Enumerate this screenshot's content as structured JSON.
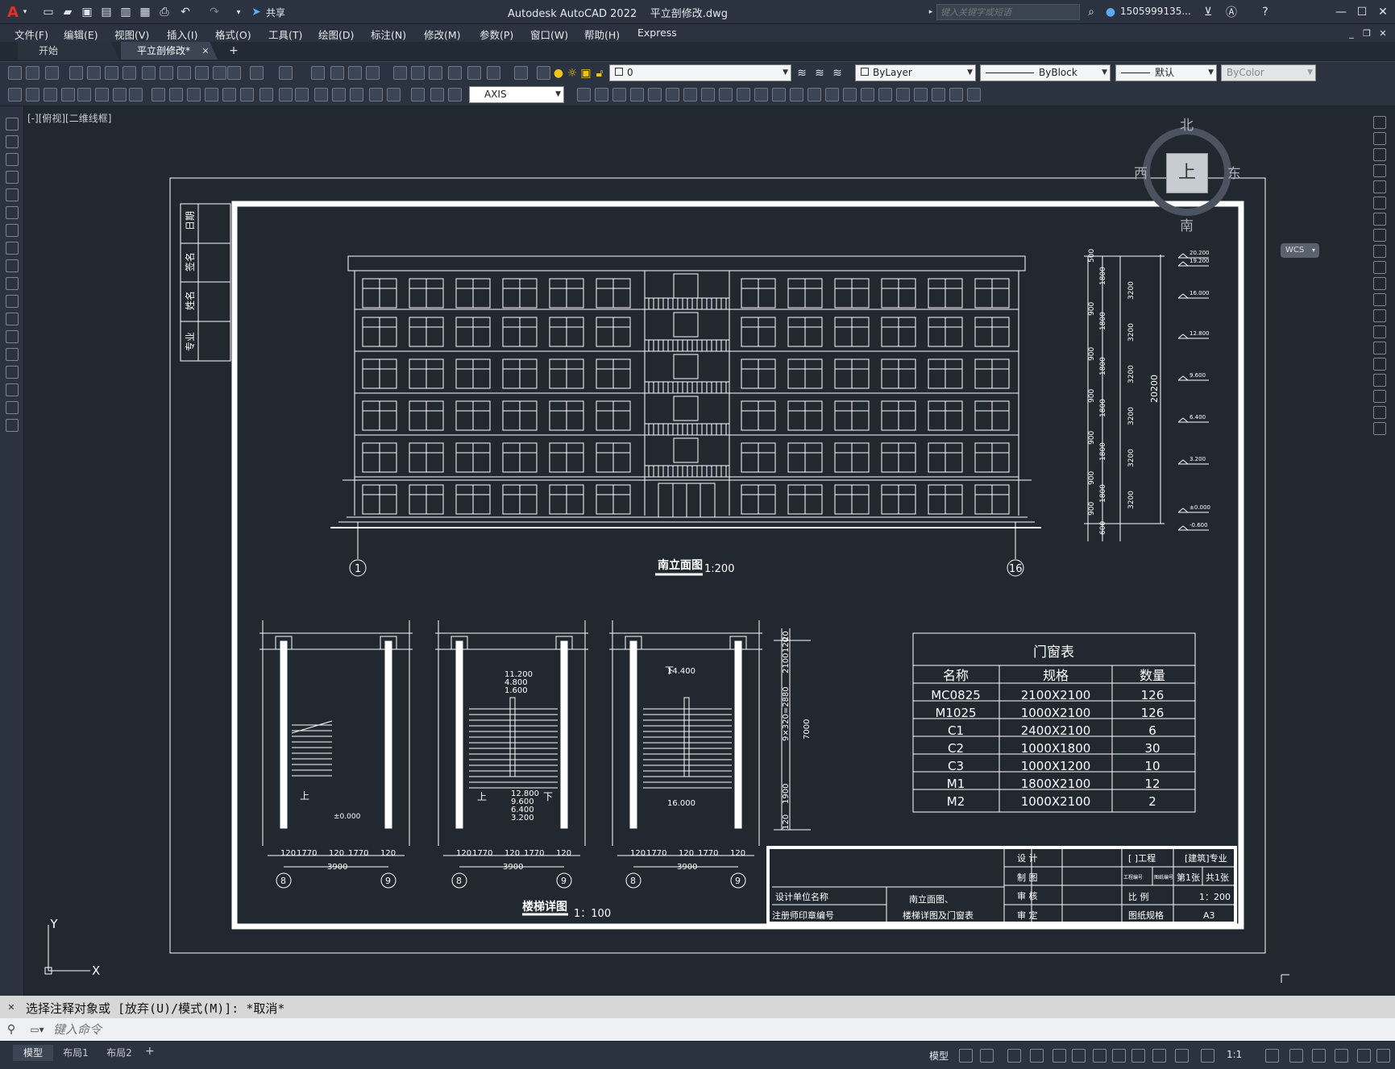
{
  "window": {
    "app_title": "Autodesk AutoCAD 2022",
    "file_title": "平立剖修改.dwg",
    "share_label": "共享",
    "search_placeholder": "键入关键字或短语",
    "user": "1505999135...",
    "logo": "A"
  },
  "menu": [
    "文件(F)",
    "编辑(E)",
    "视图(V)",
    "插入(I)",
    "格式(O)",
    "工具(T)",
    "绘图(D)",
    "标注(N)",
    "修改(M)",
    "参数(P)",
    "窗口(W)",
    "帮助(H)",
    "Express"
  ],
  "tabs": {
    "start": "开始",
    "current": "平立剖修改*",
    "new": "+"
  },
  "toolbar": {
    "layer": "0",
    "color": "ByLayer",
    "linetype": "ByBlock",
    "lineweight": "默认",
    "plotstyle": "ByColor",
    "dimstyle": "AXIS"
  },
  "viewport": {
    "label": "[-][俯视][二维线框]"
  },
  "viewcube": {
    "north": "北",
    "south": "南",
    "east": "东",
    "west": "西",
    "top": "上",
    "wcs": "WCS"
  },
  "ucs": {
    "x": "X",
    "y": "Y"
  },
  "drawing": {
    "side_labels": [
      "日期",
      "签名",
      "姓名",
      "专业"
    ],
    "elevation_title": "南立面图",
    "elevation_scale": "1:200",
    "axis_left": "1",
    "axis_right": "16",
    "levels": [
      "20.200",
      "19.200",
      "16.000",
      "12.800",
      "9.600",
      "6.400",
      "3.200",
      "±0.000",
      "-0.600"
    ],
    "dims_a": [
      "500",
      "1800",
      "900",
      "1800",
      "900",
      "1800",
      "900",
      "1800",
      "900",
      "1800",
      "900",
      "1800",
      "900",
      "600"
    ],
    "dims_b": [
      "3200",
      "3200",
      "3200",
      "3200",
      "3200",
      "3200"
    ],
    "dim_total": "20200",
    "stair_title": "楼梯详图",
    "stair_scale": "1：100",
    "stair_dims": [
      "120",
      "1770",
      "120",
      "1770",
      "120"
    ],
    "stair_total": "3900",
    "stair_axes": [
      "8",
      "9"
    ],
    "stair1": {
      "up": "上",
      "level": "±0.000"
    },
    "stair2": {
      "levels_top": [
        "11.200",
        "4.800",
        "1.600"
      ],
      "levels_bottom": [
        "12.800",
        "9.600",
        "6.400",
        "3.200"
      ],
      "up": "上",
      "down": "下"
    },
    "stair3": {
      "level_top": "14.400",
      "level_bottom": "16.000",
      "down": "下"
    },
    "stair_vdims": [
      "20",
      "120",
      "2100",
      "9×320=2880",
      "7000",
      "1900",
      "120"
    ]
  },
  "door_table": {
    "title": "门窗表",
    "headers": [
      "名称",
      "规格",
      "数量"
    ],
    "rows": [
      [
        "MC0825",
        "2100X2100",
        "126"
      ],
      [
        "M1025",
        "1000X2100",
        "126"
      ],
      [
        "C1",
        "2400X2100",
        "6"
      ],
      [
        "C2",
        "1000X1800",
        "30"
      ],
      [
        "C3",
        "1000X1200",
        "10"
      ],
      [
        "M1",
        "1800X2100",
        "12"
      ],
      [
        "M2",
        "1000X2100",
        "2"
      ]
    ]
  },
  "title_block": {
    "design": "设    计",
    "draw": "制    图",
    "check": "审    核",
    "approve": "审    定",
    "project": "[    ]工程",
    "spec": "[建筑]专业",
    "unit": "设计单位名称",
    "reg": "注册师印章编号",
    "title1": "南立面图、",
    "title2": "楼梯详图及门窗表",
    "ratio_label": "比    例",
    "ratio": "1：200",
    "paper_label": "图纸规格",
    "paper": "A3",
    "small1": "工程编号",
    "small2": "图纸编号",
    "sheet": "第1张",
    "sheets": "共1张"
  },
  "command": {
    "history": "选择注释对象或 [放弃(U)/模式(M)]: *取消*",
    "placeholder": "键入命令"
  },
  "status": {
    "layouts": [
      "模型",
      "布局1",
      "布局2"
    ],
    "add": "+",
    "model": "模型",
    "scale": "1:1"
  }
}
